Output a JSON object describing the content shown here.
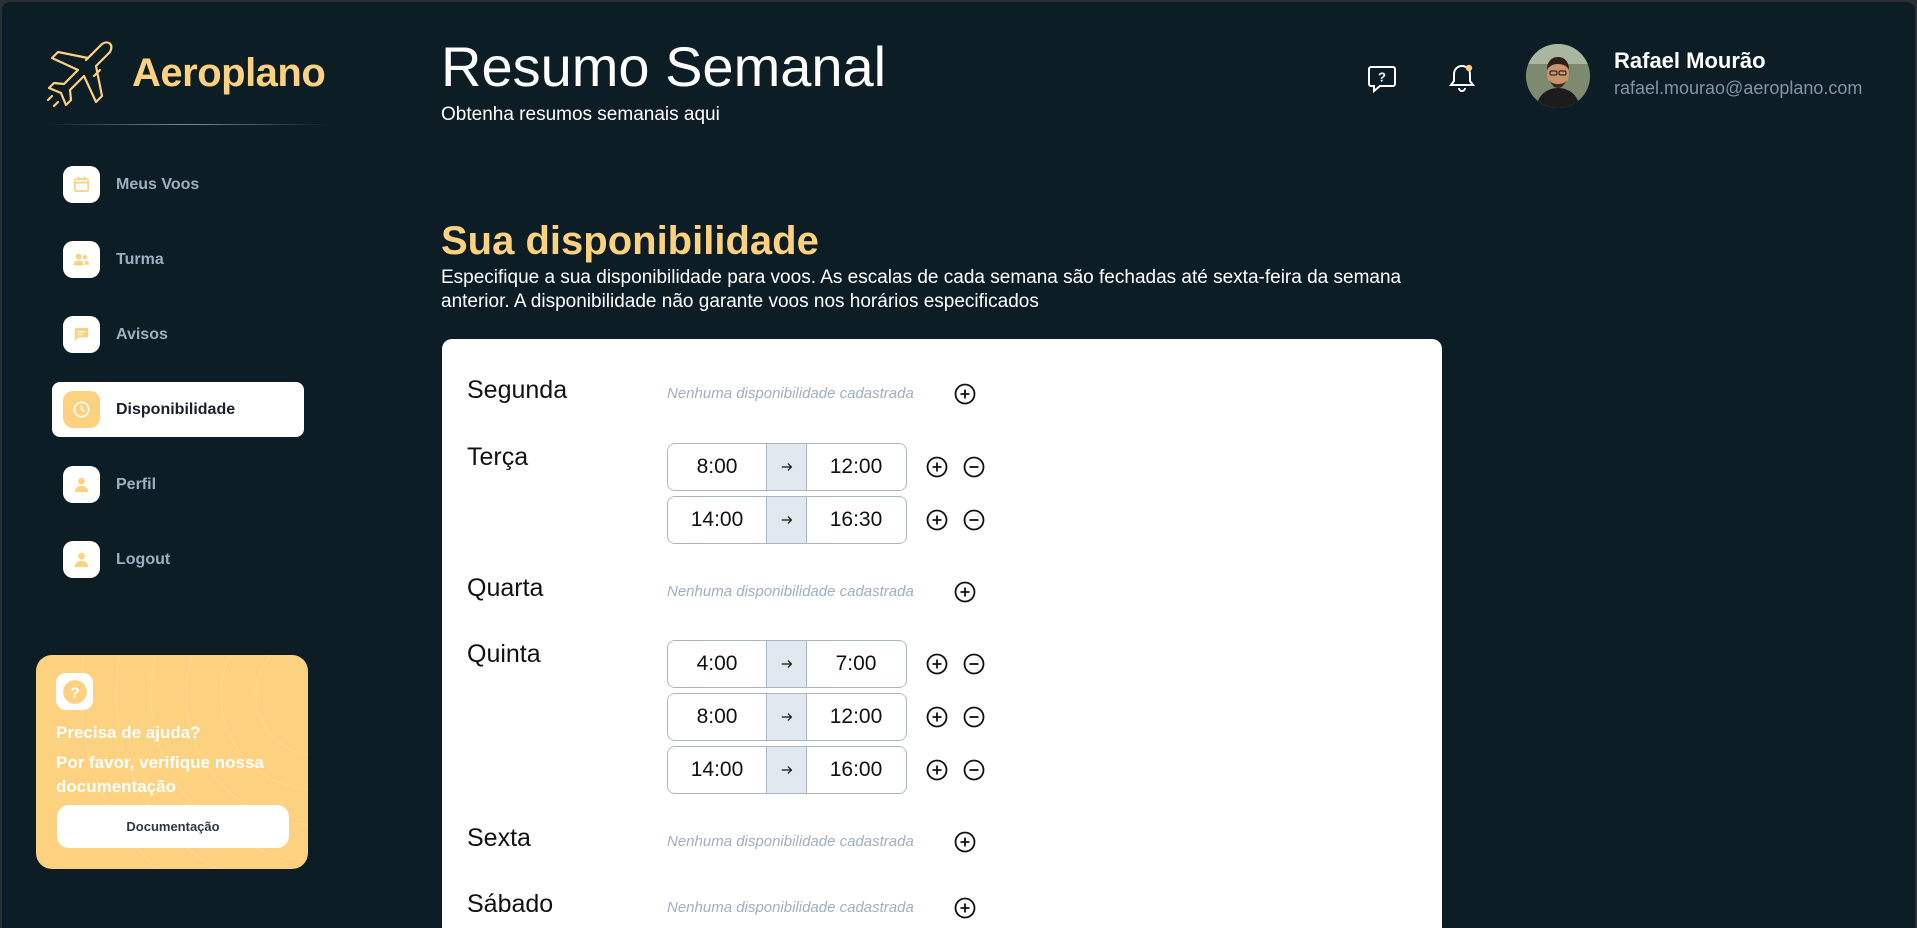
{
  "brand": {
    "name": "Aeroplano"
  },
  "sidebar": {
    "items": [
      {
        "label": "Meus Voos",
        "icon": "calendar-icon",
        "active": false
      },
      {
        "label": "Turma",
        "icon": "users-icon",
        "active": false
      },
      {
        "label": "Avisos",
        "icon": "message-icon",
        "active": false
      },
      {
        "label": "Disponibilidade",
        "icon": "clock-icon",
        "active": true
      },
      {
        "label": "Perfil",
        "icon": "user-icon",
        "active": false
      },
      {
        "label": "Logout",
        "icon": "user-icon",
        "active": false
      }
    ]
  },
  "help_card": {
    "title": "Precisa de ajuda?",
    "text": "Por favor, verifique nossa documentação",
    "button": "Documentação"
  },
  "header": {
    "title": "Resumo Semanal",
    "subtitle": "Obtenha resumos semanais aqui"
  },
  "user": {
    "name": "Rafael Mourão",
    "email": "rafael.mourao@aeroplano.com"
  },
  "availability": {
    "title": "Sua disponibilidade",
    "description": "Especifique a sua disponibilidade para voos. As escalas de cada semana são fechadas até sexta-feira da semana anterior. A disponibilidade não garante voos nos horários especificados",
    "empty_text": "Nenhuma disponibilidade cadastrada",
    "days": [
      {
        "name": "Segunda",
        "slots": []
      },
      {
        "name": "Terça",
        "slots": [
          {
            "start": "8:00",
            "end": "12:00"
          },
          {
            "start": "14:00",
            "end": "16:30"
          }
        ]
      },
      {
        "name": "Quarta",
        "slots": []
      },
      {
        "name": "Quinta",
        "slots": [
          {
            "start": "4:00",
            "end": "7:00"
          },
          {
            "start": "8:00",
            "end": "12:00"
          },
          {
            "start": "14:00",
            "end": "16:00"
          }
        ]
      },
      {
        "name": "Sexta",
        "slots": []
      },
      {
        "name": "Sábado",
        "slots": []
      }
    ]
  },
  "colors": {
    "background": "#0c1d26",
    "accent": "#fcd17f",
    "card": "#ffffff",
    "muted": "#a0aec0"
  }
}
